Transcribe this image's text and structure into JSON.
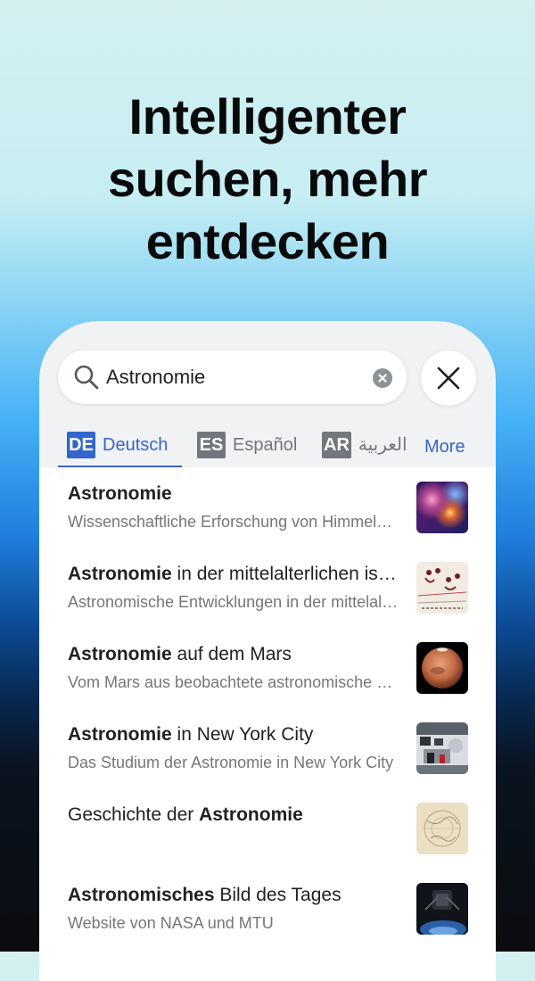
{
  "headline": [
    "Intelligenter",
    "suchen, mehr",
    "entdecken"
  ],
  "search": {
    "query": "Astronomie",
    "icon": "search-icon",
    "clear_icon": "clear-icon"
  },
  "close_icon": "close-icon",
  "languages": [
    {
      "code": "DE",
      "name": "Deutsch",
      "active": true,
      "code_color": "#3366cc",
      "name_color": "#3366cc"
    },
    {
      "code": "ES",
      "name": "Español",
      "active": false,
      "code_color": "#72777d",
      "name_color": "#72777d"
    },
    {
      "code": "AR",
      "name": "العربية",
      "active": false,
      "code_color": "#72777d",
      "name_color": "#72777d"
    }
  ],
  "more_label": "More",
  "results": [
    {
      "title_bold": "Astronomie",
      "title_rest": "",
      "title_prefix": "",
      "description": "Wissenschaftliche Erforschung von Himmelskörpern",
      "thumb": "nebula-image"
    },
    {
      "title_bold": "Astronomie",
      "title_rest": " in der mittelalterlichen islamischen Welt",
      "title_prefix": "",
      "description": "Astronomische Entwicklungen in der mittelalterlichen islamischen Welt",
      "thumb": "manuscript-image"
    },
    {
      "title_bold": "Astronomie",
      "title_rest": " auf dem Mars",
      "title_prefix": "",
      "description": "Vom Mars aus beobachtete astronomische Phänomene",
      "thumb": "mars-image"
    },
    {
      "title_bold": "Astronomie",
      "title_rest": " in New York City",
      "title_prefix": "",
      "description": "Das Studium der Astronomie in New York City",
      "thumb": "observatory-image"
    },
    {
      "title_bold": "Astronomie",
      "title_rest": "",
      "title_prefix": "Geschichte der ",
      "description": "",
      "thumb": "old-star-chart-image"
    },
    {
      "title_bold": "Astronomisches",
      "title_rest": " Bild des Tages",
      "title_prefix": "",
      "description": "Website von NASA und MTU",
      "thumb": "telescope-image"
    }
  ],
  "colors": {
    "accent": "#3366cc",
    "text": "#202122",
    "secondary_text": "#72777d"
  }
}
